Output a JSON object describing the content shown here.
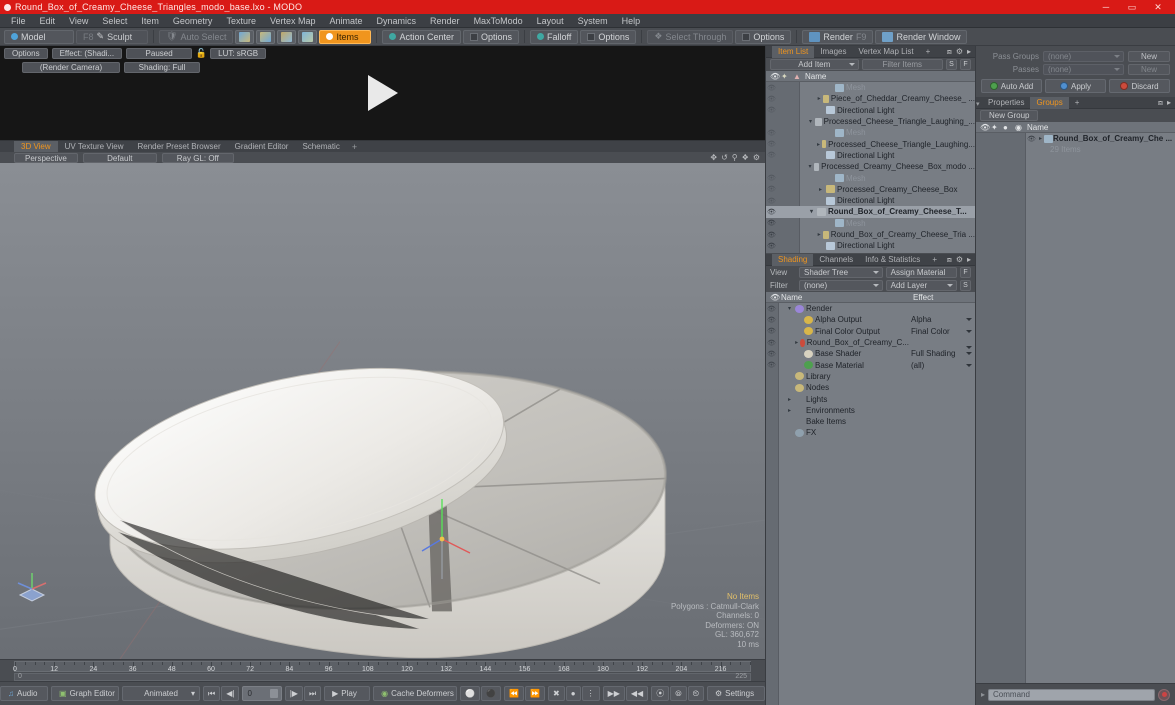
{
  "window": {
    "title": "Round_Box_of_Creamy_Cheese_Triangles_modo_base.lxo - MODO",
    "minimize": "─",
    "maximize": "▭",
    "close": "✕",
    "accent_red": "#d91a16",
    "accent_orange": "#f0951e"
  },
  "menubar": {
    "items": [
      "File",
      "Edit",
      "View",
      "Select",
      "Item",
      "Geometry",
      "Texture",
      "Vertex Map",
      "Animate",
      "Dynamics",
      "Render",
      "MaxToModo",
      "Layout",
      "System",
      "Help"
    ]
  },
  "modebar": {
    "model": "Model",
    "f8": "F8",
    "sculpt": "Sculpt",
    "auto_select": "Auto Select",
    "items": "Items",
    "action_center": "Action Center",
    "options1": "Options",
    "falloff": "Falloff",
    "options2": "Options",
    "select_through": "Select Through",
    "options3": "Options",
    "render": "Render",
    "render_key": "F9",
    "render_window": "Render Window"
  },
  "preview": {
    "options": "Options",
    "effect": "Effect: (Shadi...",
    "paused": "Paused",
    "lut": "LUT: sRGB",
    "camera": "(Render Camera)",
    "shading": "Shading: Full"
  },
  "viewport": {
    "tabs": [
      "3D View",
      "UV Texture View",
      "Render Preset Browser",
      "Gradient Editor",
      "Schematic"
    ],
    "tab_plus": "+",
    "active_tab": "3D View",
    "perspective": "Perspective",
    "default": "Default",
    "raygl": "Ray GL: Off",
    "stats": {
      "no_items": "No Items",
      "polygons": "Polygons : Catmull-Clark",
      "channels": "Channels: 0",
      "deformers": "Deformers: ON",
      "gl": "GL: 360,672",
      "ms": "10 ms"
    }
  },
  "timeline": {
    "ticks": [
      0,
      12,
      24,
      36,
      48,
      60,
      72,
      84,
      96,
      108,
      120,
      132,
      144,
      156,
      168,
      180,
      192,
      204,
      216
    ],
    "start_label": "0",
    "end_label": "225",
    "range_start": "0",
    "range_end": "225"
  },
  "bottombar": {
    "audio": "Audio",
    "graph_editor": "Graph Editor",
    "animated": "Animated",
    "frame_value": "0",
    "play": "Play",
    "cache_deformers": "Cache Deformers",
    "settings": "Settings"
  },
  "item_list": {
    "tabs": [
      "Item List",
      "Images",
      "Vertex Map List"
    ],
    "tab_plus": "+",
    "active_tab": "Item List",
    "add_item": "Add Item",
    "filter_items": "Filter Items",
    "filter_s": "S",
    "filter_f": "F",
    "col_name": "Name",
    "rows": [
      {
        "indent": 3,
        "label": "Mesh",
        "arrow": "",
        "dim": true,
        "icon": "#9fb6c8",
        "eye": "dim"
      },
      {
        "indent": 2,
        "label": "Piece_of_Cheddar_Creamy_Cheese_ ...",
        "arrow": "▸",
        "dim": false,
        "icon": "#c8b87a",
        "eye": "dim"
      },
      {
        "indent": 2,
        "label": "Directional Light",
        "arrow": "",
        "dim": false,
        "icon": "#b8c8d8",
        "eye": "dim"
      },
      {
        "indent": 1,
        "label": "Processed_Cheese_Triangle_Laughing_...",
        "arrow": "▾",
        "dim": false,
        "icon": "#b0b6bc",
        "eye": "none"
      },
      {
        "indent": 3,
        "label": "Mesh",
        "arrow": "",
        "dim": true,
        "icon": "#9fb6c8",
        "eye": "dim"
      },
      {
        "indent": 2,
        "label": "Processed_Cheese_Triangle_Laughing...",
        "arrow": "▸",
        "dim": false,
        "icon": "#c8b87a",
        "eye": "dim"
      },
      {
        "indent": 2,
        "label": "Directional Light",
        "arrow": "",
        "dim": false,
        "icon": "#b8c8d8",
        "eye": "dim"
      },
      {
        "indent": 1,
        "label": "Processed_Creamy_Cheese_Box_modo ...",
        "arrow": "▾",
        "dim": false,
        "icon": "#b0b6bc",
        "eye": "none"
      },
      {
        "indent": 3,
        "label": "Mesh",
        "arrow": "",
        "dim": true,
        "icon": "#9fb6c8",
        "eye": "dim"
      },
      {
        "indent": 2,
        "label": "Processed_Creamy_Cheese_Box",
        "arrow": "▸",
        "dim": false,
        "icon": "#c8b87a",
        "eye": "dim"
      },
      {
        "indent": 2,
        "label": "Directional Light",
        "arrow": "",
        "dim": false,
        "icon": "#b8c8d8",
        "eye": "dim"
      },
      {
        "indent": 1,
        "label": "Round_Box_of_Creamy_Cheese_T...",
        "arrow": "▾",
        "dim": false,
        "icon": "#b0b6bc",
        "eye": "on",
        "bold": true
      },
      {
        "indent": 3,
        "label": "Mesh",
        "arrow": "",
        "dim": true,
        "icon": "#9fb6c8",
        "eye": "on"
      },
      {
        "indent": 2,
        "label": "Round_Box_of_Creamy_Cheese_Tria ...",
        "arrow": "▸",
        "dim": false,
        "icon": "#c8b87a",
        "eye": "on"
      },
      {
        "indent": 2,
        "label": "Directional Light",
        "arrow": "",
        "dim": false,
        "icon": "#b8c8d8",
        "eye": "on"
      }
    ]
  },
  "shading": {
    "tabs": [
      "Shading",
      "Channels",
      "Info & Statistics"
    ],
    "tab_plus": "+",
    "active_tab": "Shading",
    "view_label": "View",
    "view_value": "Shader Tree",
    "assign_material": "Assign Material",
    "assign_f": "F",
    "filter_label": "Filter",
    "filter_value": "(none)",
    "add_layer": "Add Layer",
    "add_s": "S",
    "col_name": "Name",
    "col_effect": "Effect",
    "rows": [
      {
        "indent": 1,
        "label": "Render",
        "effect": "",
        "arrow": "▾",
        "icon": "#9a86d8",
        "caret": false
      },
      {
        "indent": 2,
        "label": "Alpha Output",
        "effect": "Alpha",
        "arrow": "",
        "icon": "#d8b64a",
        "caret": true
      },
      {
        "indent": 2,
        "label": "Final Color Output",
        "effect": "Final Color",
        "arrow": "",
        "icon": "#d8b64a",
        "caret": true
      },
      {
        "indent": 2,
        "label": "Round_Box_of_Creamy_C...",
        "effect": "",
        "arrow": "▸",
        "icon": "#cc4b3c",
        "caret": true
      },
      {
        "indent": 2,
        "label": "Base Shader",
        "effect": "Full Shading",
        "arrow": "",
        "icon": "#d8d2c0",
        "caret": true
      },
      {
        "indent": 2,
        "label": "Base Material",
        "effect": "(all)",
        "arrow": "",
        "icon": "#4ea04e",
        "caret": true
      },
      {
        "indent": 1,
        "label": "Library",
        "effect": "",
        "arrow": "",
        "icon": "#c8b87a",
        "caret": false
      },
      {
        "indent": 1,
        "label": "Nodes",
        "effect": "",
        "arrow": "",
        "icon": "#c8b87a",
        "caret": false
      },
      {
        "indent": 1,
        "label": "Lights",
        "effect": "",
        "arrow": "▸",
        "icon": "",
        "caret": false
      },
      {
        "indent": 1,
        "label": "Environments",
        "effect": "",
        "arrow": "▸",
        "icon": "",
        "caret": false
      },
      {
        "indent": 1,
        "label": "Bake Items",
        "effect": "",
        "arrow": "",
        "icon": "",
        "caret": false
      },
      {
        "indent": 1,
        "label": "FX",
        "effect": "",
        "arrow": "",
        "icon": "#8fa0ad",
        "caret": false
      }
    ]
  },
  "right_panel": {
    "pass_groups_label": "Pass Groups",
    "pass_groups_value": "(none)",
    "pass_groups_new": "New",
    "passes_label": "Passes",
    "passes_value": "(none)",
    "passes_new": "New",
    "auto_add": "Auto Add",
    "apply": "Apply",
    "discard": "Discard",
    "tabs": [
      "Properties",
      "Groups"
    ],
    "tab_plus": "+",
    "active_tab": "Groups",
    "new_group": "New Group",
    "col_name": "Name",
    "group_row": "Round_Box_of_Creamy_Che ...",
    "group_count": "29 Items",
    "command_placeholder": "Command"
  }
}
